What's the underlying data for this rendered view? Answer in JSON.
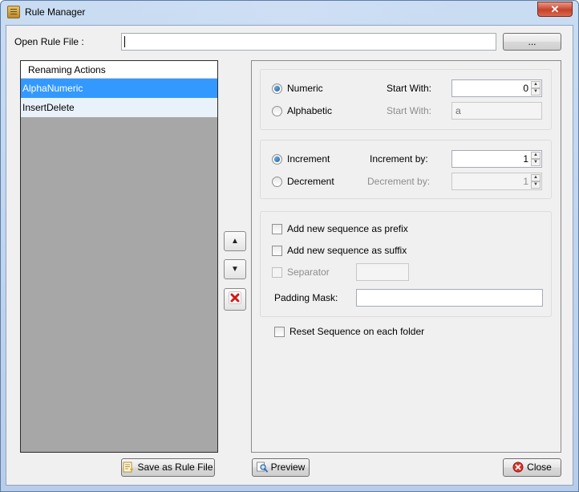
{
  "window": {
    "title": "Rule Manager",
    "close_glyph": "✕"
  },
  "open_rule_file": {
    "label": "Open Rule File :",
    "value": "",
    "browse_label": "..."
  },
  "list": {
    "header": "Renaming Actions",
    "items": [
      {
        "label": "AlphaNumeric",
        "selected": true
      },
      {
        "label": "InsertDelete",
        "selected": false
      }
    ]
  },
  "side_buttons": {
    "up_glyph": "▲",
    "down_glyph": "▼",
    "delete_icon": "delete-x-icon"
  },
  "type_group": {
    "numeric_label": "Numeric",
    "numeric_selected": true,
    "alphabetic_label": "Alphabetic",
    "alphabetic_selected": false,
    "start_with_label": "Start With:",
    "start_with_value": "0",
    "alpha_start_with_label": "Start With:",
    "alpha_start_with_value": "a"
  },
  "direction_group": {
    "increment_label": "Increment",
    "increment_selected": true,
    "decrement_label": "Decrement",
    "decrement_selected": false,
    "increment_by_label": "Increment by:",
    "increment_by_value": "1",
    "decrement_by_label": "Decrement by:",
    "decrement_by_value": "1"
  },
  "options_group": {
    "prefix_label": "Add new sequence as prefix",
    "suffix_label": "Add new sequence as suffix",
    "separator_label": "Separator",
    "padding_mask_label": "Padding Mask:",
    "padding_mask_value": ""
  },
  "reset_label": "Reset Sequence on each folder",
  "footer": {
    "save_label": "Save as Rule File",
    "preview_label": "Preview",
    "close_label": "Close"
  },
  "colors": {
    "selection": "#3399ff",
    "list_bg": "#a7a7a7",
    "close_button": "#c7412a"
  }
}
